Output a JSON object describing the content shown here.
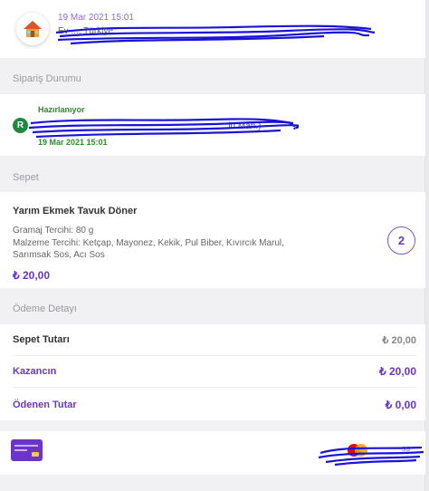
{
  "address": {
    "date": "19 Mar 2021 15:01",
    "text": "Ev ..., Türkiye",
    "icon": "house-icon"
  },
  "status_section": {
    "label": "Sipariş Durumu",
    "status": "Hazırlanıyor",
    "badge": "R",
    "place": "...lu Mah.)",
    "date": "19 Mar 2021 15:01"
  },
  "basket": {
    "label": "Sepet",
    "product": {
      "name": "Yarım Ekmek Tavuk Döner",
      "line1": "Gramaj Tercihi: 80 g",
      "line2": "Malzeme Tercihi: Ketçap, Mayonez, Kekik, Pul Biber, Kıvırcık Marul,",
      "line3": "Sarımsak Sos, Acı Sos",
      "price": "₺ 20,00",
      "quantity": "2"
    }
  },
  "payment": {
    "label": "Ödeme Detayı",
    "rows": [
      {
        "label": "Sepet Tutarı",
        "value": "₺ 20,00"
      },
      {
        "label": "Kazancın",
        "value": "₺ 20,00"
      },
      {
        "label": "Ödenen Tutar",
        "value": "₺ 0,00"
      }
    ],
    "card_suffix": "ss"
  },
  "colors": {
    "purple": "#6b36c8",
    "green": "#2e8b2e",
    "label_gray": "#9a9aa3",
    "scribble": "#1a14d9"
  }
}
